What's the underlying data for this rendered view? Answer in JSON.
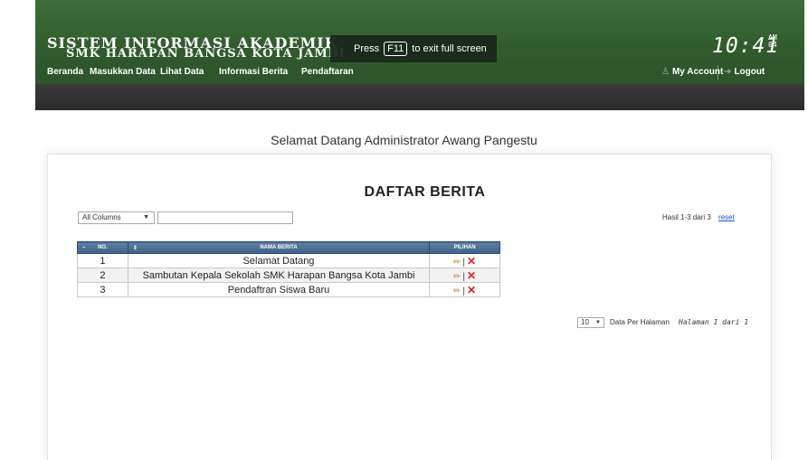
{
  "header": {
    "title_line1": "SISTEM INFORMASI AKADEMIK",
    "title_line2": "SMK HARAPAN BANGSA KOTA JAMBI",
    "fullscreen_tip_before": "Press",
    "fullscreen_tip_key": "F11",
    "fullscreen_tip_after": "to exit full screen",
    "clock": "10:41",
    "clock_ampm": "AM",
    "clock_seconds": "04"
  },
  "menu": {
    "items": [
      "Beranda",
      "Masukkan Data",
      "Lihat Data",
      "Informasi Berita",
      "Pendaftaran"
    ],
    "my_account": "My Account",
    "logout": "Logout",
    "my_account_icon": "user-icon",
    "logout_icon": "logout-arrow-icon"
  },
  "welcome": "Selamat Datang Administrator Awang Pangestu",
  "panel": {
    "heading": "DAFTAR BERITA",
    "filter": {
      "column_select_value": "All Columns",
      "search_value": ""
    },
    "result_info": "Hasil 1-3 dari 3",
    "reset_label": "reset",
    "table": {
      "headers": [
        "NO.",
        "NAMA BERITA",
        "PILIHAN"
      ],
      "rows": [
        {
          "no": "1",
          "nama": "Selamat Datang"
        },
        {
          "no": "2",
          "nama": "Sambutan Kepala Sekolah SMK Harapan Bangsa Kota Jambi"
        },
        {
          "no": "3",
          "nama": "Pendaftran Siswa Baru"
        }
      ],
      "action_separator": "|"
    },
    "pagination": {
      "per_page_value": "10",
      "per_page_label": "Data Per Halaman",
      "page_info": "Halaman 1 dari 1"
    }
  },
  "colors": {
    "header_green": "#3d6e38",
    "table_header_blue": "#4f7096",
    "delete_red": "#e02020",
    "link_blue": "#1a4fd0"
  }
}
